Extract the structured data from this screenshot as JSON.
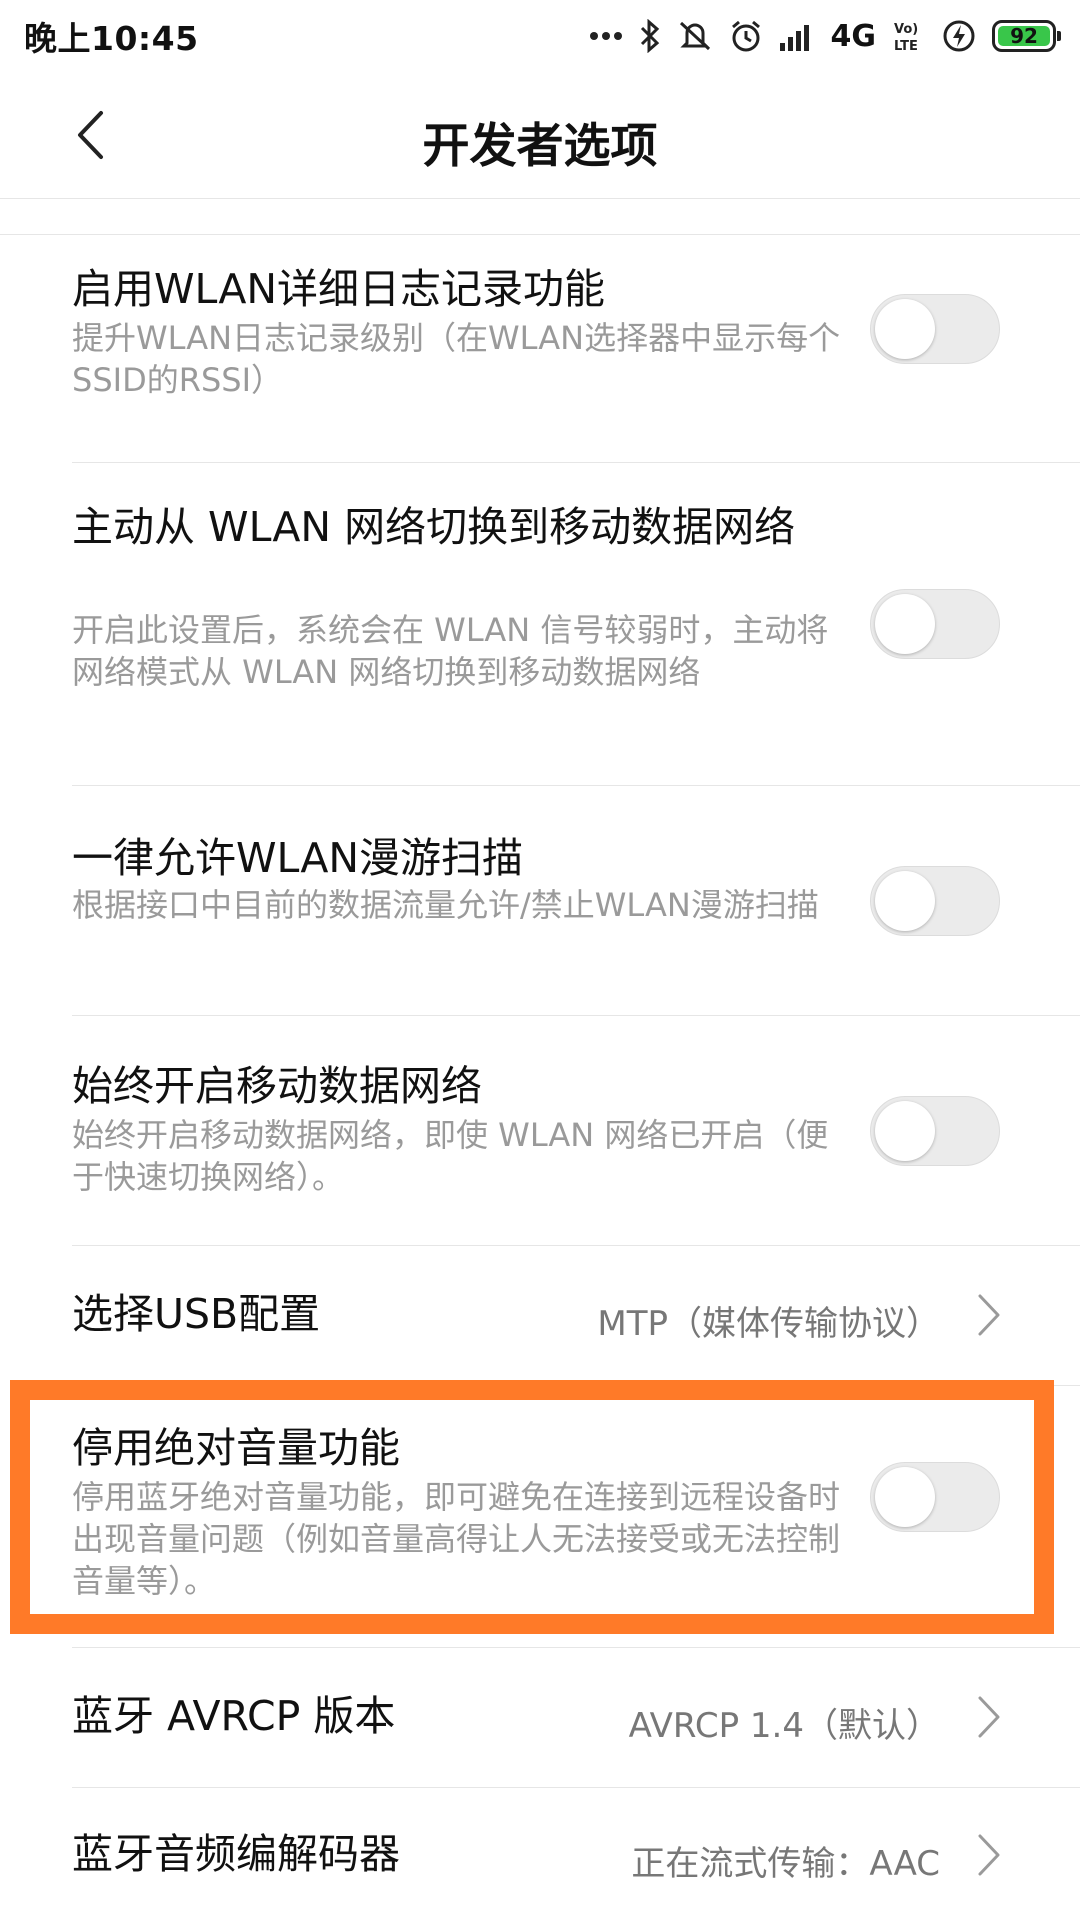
{
  "status_bar": {
    "time": "晚上10:45",
    "network": "4G",
    "volte": "Vo LTE",
    "battery_level": "92",
    "battery_color": "#39c64a",
    "icons": [
      "more-dots-icon",
      "bluetooth-icon",
      "mute-icon",
      "alarm-icon",
      "signal-icon",
      "volte-icon",
      "charging-icon",
      "battery-icon"
    ]
  },
  "header": {
    "title": "开发者选项",
    "back_icon": "chevron-left-icon"
  },
  "settings": [
    {
      "title": "启用WLAN详细日志记录功能",
      "subtitle": "提升WLAN日志记录级别（在WLAN选择器中显示每个SSID的RSSI）",
      "type": "toggle",
      "enabled": false
    },
    {
      "title": "主动从 WLAN 网络切换到移动数据网络",
      "subtitle": "开启此设置后，系统会在 WLAN 信号较弱时，主动将网络模式从 WLAN 网络切换到移动数据网络",
      "type": "toggle",
      "enabled": false
    },
    {
      "title": "一律允许WLAN漫游扫描",
      "subtitle": "根据接口中目前的数据流量允许/禁止WLAN漫游扫描",
      "type": "toggle",
      "enabled": false
    },
    {
      "title": "始终开启移动数据网络",
      "subtitle": "始终开启移动数据网络，即使 WLAN 网络已开启（便于快速切换网络）。",
      "type": "toggle",
      "enabled": false
    },
    {
      "title": "选择USB配置",
      "value": "MTP（媒体传输协议）",
      "type": "select"
    },
    {
      "title": "停用绝对音量功能",
      "subtitle": "停用蓝牙绝对音量功能，即可避免在连接到远程设备时出现音量问题（例如音量高得让人无法接受或无法控制音量等）。",
      "type": "toggle",
      "enabled": false,
      "highlighted": true
    },
    {
      "title": "蓝牙 AVRCP 版本",
      "value": "AVRCP 1.4（默认）",
      "type": "select"
    },
    {
      "title": "蓝牙音频编解码器",
      "value": "正在流式传输：AAC",
      "type": "select"
    }
  ],
  "highlight_color": "#ff7a28"
}
